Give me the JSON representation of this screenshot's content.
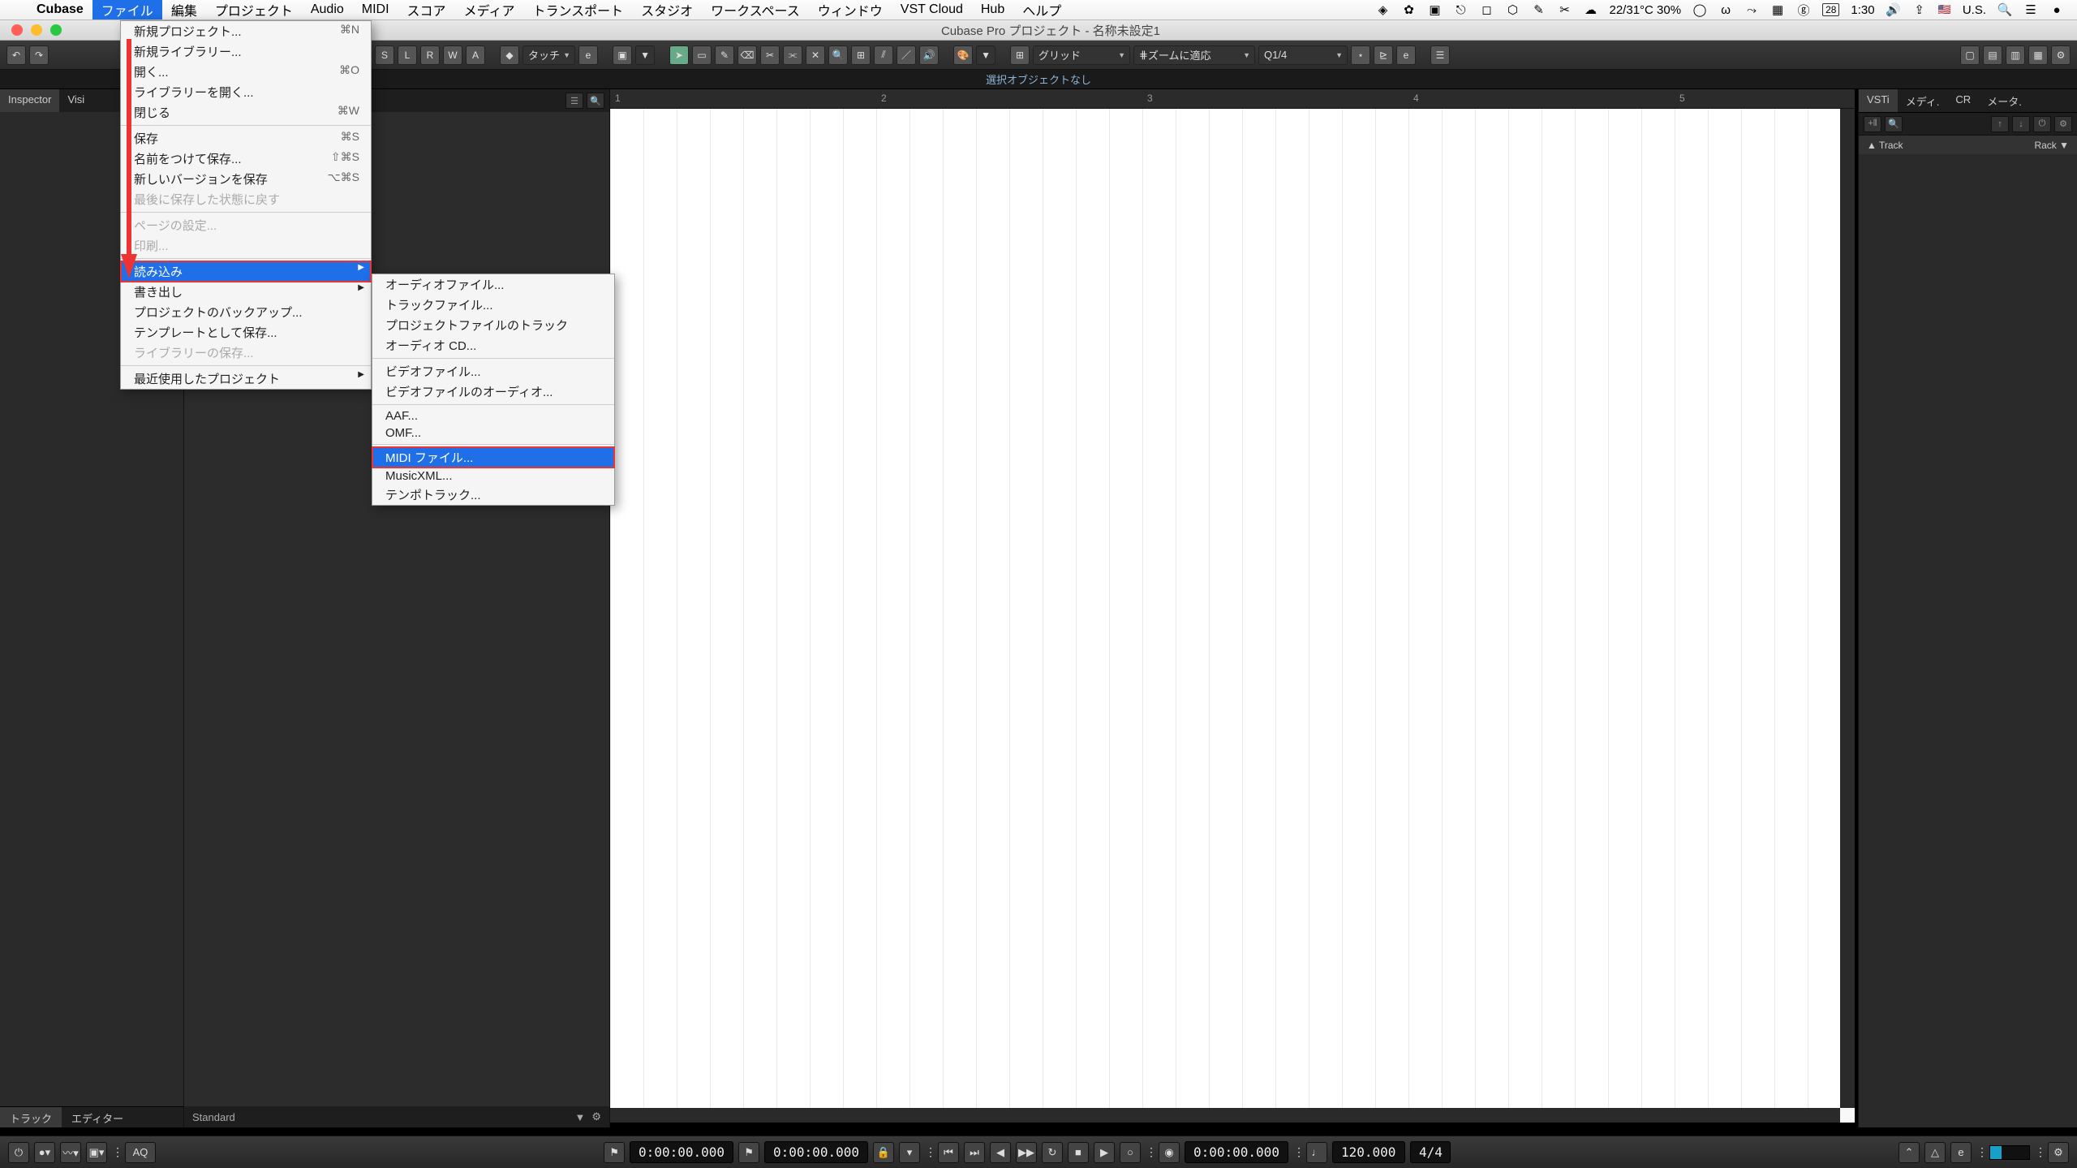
{
  "macMenu": {
    "appName": "Cubase",
    "items": [
      "ファイル",
      "編集",
      "プロジェクト",
      "Audio",
      "MIDI",
      "スコア",
      "メディア",
      "トランスポート",
      "スタジオ",
      "ワークスペース",
      "ウィンドウ",
      "VST Cloud",
      "Hub",
      "ヘルプ"
    ],
    "statusWeather": "22/31°C 30%",
    "statusBattery": "28",
    "statusTime": "1:30",
    "statusLang": "U.S."
  },
  "window": {
    "title": "Cubase Pro プロジェクト - 名称未設定1"
  },
  "toolbar": {
    "automationMode": "タッチ",
    "snapMode": "グリッド",
    "zoomMode": "ズームに適応",
    "quantize": "1/4"
  },
  "infoBar": {
    "text": "選択オブジェクトなし"
  },
  "leftTabs": {
    "a": "Inspector",
    "b": "Visi"
  },
  "leftBottom": {
    "a": "トラック",
    "b": "エディター"
  },
  "tracklistFooter": {
    "preset": "Standard"
  },
  "rightTabs": {
    "a": "VSTi",
    "b": "メディ.",
    "c": "CR",
    "d": "メータ."
  },
  "rightCols": {
    "a": "Track",
    "b": "Rack"
  },
  "ruler": {
    "bars": [
      "1",
      "2",
      "3",
      "4",
      "5"
    ]
  },
  "fileMenu": {
    "newProject": "新規プロジェクト...",
    "scNew": "⌘N",
    "newLibrary": "新規ライブラリー...",
    "open": "開く...",
    "scOpen": "⌘O",
    "openLibrary": "ライブラリーを開く...",
    "close": "閉じる",
    "scClose": "⌘W",
    "save": "保存",
    "scSave": "⌘S",
    "saveAs": "名前をつけて保存...",
    "scSaveAs": "⇧⌘S",
    "saveVersion": "新しいバージョンを保存",
    "scSaveVer": "⌥⌘S",
    "revert": "最後に保存した状態に戻す",
    "pageSetup": "ページの設定...",
    "print": "印刷...",
    "import": "読み込み",
    "export": "書き出し",
    "backup": "プロジェクトのバックアップ...",
    "saveTemplate": "テンプレートとして保存...",
    "saveLibrary": "ライブラリーの保存...",
    "recent": "最近使用したプロジェクト"
  },
  "importMenu": {
    "audioFile": "オーディオファイル...",
    "trackFile": "トラックファイル...",
    "projectTracks": "プロジェクトファイルのトラック",
    "audioCD": "オーディオ CD...",
    "videoFile": "ビデオファイル...",
    "videoAudio": "ビデオファイルのオーディオ...",
    "aaf": "AAF...",
    "omf": "OMF...",
    "midi": "MIDI ファイル...",
    "musicxml": "MusicXML...",
    "tempoTrack": "テンポトラック..."
  },
  "transport": {
    "left": "0:00:00.000",
    "right": "0:00:00.000",
    "main": "0:00:00.000",
    "tempo": "120.000",
    "sig": "4/4"
  }
}
